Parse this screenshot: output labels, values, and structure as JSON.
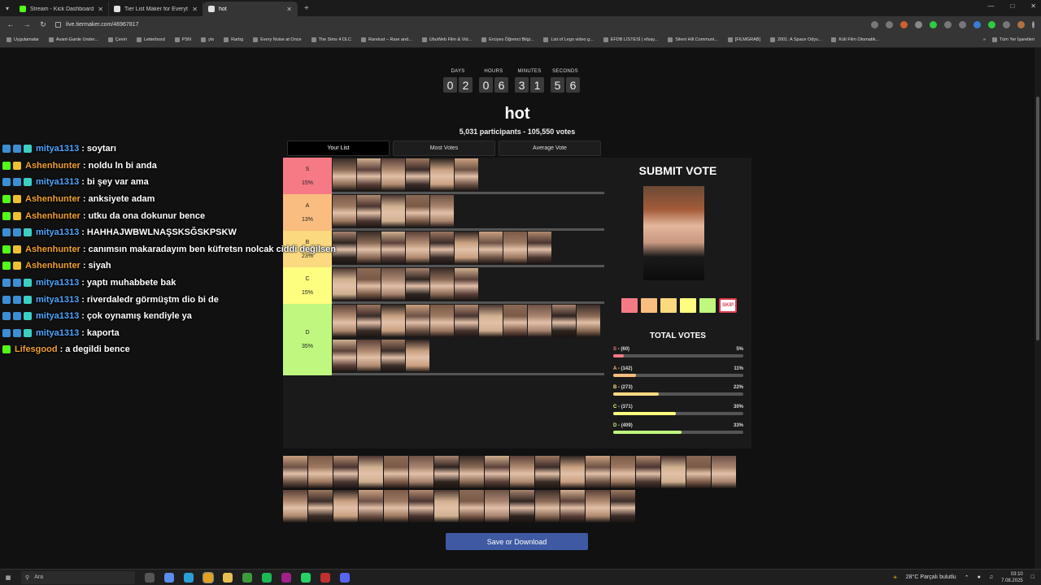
{
  "browser": {
    "tabs": [
      {
        "title": "Stream - Kick Dashboard",
        "icon_color": "#53fc18",
        "active": false
      },
      {
        "title": "Tier List Maker for Everything",
        "icon_color": "#e0e0e0",
        "active": false
      },
      {
        "title": "hot",
        "icon_color": "#e0e0e0",
        "active": true
      }
    ],
    "new_tab": "+",
    "url": "live.tiermaker.com/46967817",
    "bookmarks": [
      "Uygulamalar",
      "Avant-Garde Under...",
      "Çeviri",
      "Letterboxd",
      "PSN",
      "yts",
      "Rarbg",
      "Every Noise at Once",
      "The Sims 4 DLC",
      "Rarelust – Rare and...",
      "UbuWeb Film & Vid...",
      "Erciyes Öğrenci Bilgi...",
      "List of Lego video g...",
      "EFDB LİSTESİ | efsay...",
      "Silent Hill Communi...",
      "[FILMGRAB]",
      "2001: A Space Odys...",
      "Kült Film Otomatik..."
    ],
    "bookmarks_all": "Tüm Yer İşaretleri"
  },
  "countdown": [
    {
      "label": "DAYS",
      "digits": [
        "0",
        "2"
      ]
    },
    {
      "label": "HOURS",
      "digits": [
        "0",
        "6"
      ]
    },
    {
      "label": "MINUTES",
      "digits": [
        "3",
        "1"
      ]
    },
    {
      "label": "SECONDS",
      "digits": [
        "5",
        "6"
      ]
    }
  ],
  "title": "hot",
  "stats": "5,031 participants - 105,550 votes",
  "view_tabs": [
    "Your List",
    "Most Votes",
    "Average Vote"
  ],
  "tiers": [
    {
      "letter": "S",
      "percent": "15%",
      "color": "#f67a85",
      "count": 6
    },
    {
      "letter": "A",
      "percent": "13%",
      "color": "#f9bd7f",
      "count": 5
    },
    {
      "letter": "B",
      "percent": "23%",
      "color": "#fbd97f",
      "count": 9
    },
    {
      "letter": "C",
      "percent": "15%",
      "color": "#fdfd7f",
      "count": 6
    },
    {
      "letter": "D",
      "percent": "35%",
      "color": "#bff77f",
      "count": 15
    }
  ],
  "submit": {
    "title": "SUBMIT VOTE",
    "skip": "SKIP",
    "swatches": [
      "#f67a85",
      "#f9bd7f",
      "#fbd97f",
      "#fdfd7f",
      "#bff77f"
    ]
  },
  "total_votes": {
    "title": "TOTAL VOTES",
    "rows": [
      {
        "label": "S",
        "count": "(60)",
        "percent": "5%",
        "fraction": 0.05,
        "color": "#f67a85"
      },
      {
        "label": "A",
        "count": "(142)",
        "percent": "11%",
        "fraction": 0.11,
        "color": "#f9bd7f"
      },
      {
        "label": "B",
        "count": "(273)",
        "percent": "22%",
        "fraction": 0.22,
        "color": "#fbd97f"
      },
      {
        "label": "C",
        "count": "(371)",
        "percent": "30%",
        "fraction": 0.3,
        "color": "#fdfd7f"
      },
      {
        "label": "D",
        "count": "(409)",
        "percent": "33%",
        "fraction": 0.33,
        "color": "#bff77f"
      }
    ]
  },
  "pool_rows": [
    18,
    14
  ],
  "save_button": "Save or Download",
  "chat": [
    {
      "user": "mitya1313",
      "msg": "soytarı",
      "color": "#4da6ff",
      "badges": [
        "#3c8fd4",
        "#3c8fd4",
        "#3bd0c4"
      ]
    },
    {
      "user": "Ashenhunter",
      "msg": "noldu ln bi anda",
      "color": "#f0a030",
      "badges": [
        "#53fc18",
        "#f0c030"
      ]
    },
    {
      "user": "mitya1313",
      "msg": "bi şey var ama",
      "color": "#4da6ff",
      "badges": [
        "#3c8fd4",
        "#3c8fd4",
        "#3bd0c4"
      ]
    },
    {
      "user": "Ashenhunter",
      "msg": "anksiyete adam",
      "color": "#f0a030",
      "badges": [
        "#53fc18",
        "#f0c030"
      ]
    },
    {
      "user": "Ashenhunter",
      "msg": "utku da ona dokunur bence",
      "color": "#f0a030",
      "badges": [
        "#53fc18",
        "#f0c030"
      ]
    },
    {
      "user": "mitya1313",
      "msg": "HAHHAJWBWLNAŞSKSĞSKPSKW",
      "color": "#4da6ff",
      "badges": [
        "#3c8fd4",
        "#3c8fd4",
        "#3bd0c4"
      ]
    },
    {
      "user": "Ashenhunter",
      "msg": "canımsın makaradayım ben küfretsn nolcak ciddi değilsen",
      "color": "#f0a030",
      "badges": [
        "#53fc18",
        "#f0c030"
      ]
    },
    {
      "user": "Ashenhunter",
      "msg": "siyah",
      "color": "#f0a030",
      "badges": [
        "#53fc18",
        "#f0c030"
      ]
    },
    {
      "user": "mitya1313",
      "msg": "yaptı muhabbete bak",
      "color": "#4da6ff",
      "badges": [
        "#3c8fd4",
        "#3c8fd4",
        "#3bd0c4"
      ]
    },
    {
      "user": "mitya1313",
      "msg": "riverdaledr görmüştm dio bi de",
      "color": "#4da6ff",
      "badges": [
        "#3c8fd4",
        "#3c8fd4",
        "#3bd0c4"
      ]
    },
    {
      "user": "mitya1313",
      "msg": "çok oynamış kendiyle ya",
      "color": "#4da6ff",
      "badges": [
        "#3c8fd4",
        "#3c8fd4",
        "#3bd0c4"
      ]
    },
    {
      "user": "mitya1313",
      "msg": "kaporta",
      "color": "#4da6ff",
      "badges": [
        "#3c8fd4",
        "#3c8fd4",
        "#3bd0c4"
      ]
    },
    {
      "user": "Lifesgood",
      "msg": "a degildi bence",
      "color": "#f0a030",
      "badges": [
        "#53fc18"
      ]
    }
  ],
  "taskbar": {
    "search_placeholder": "Ara",
    "weather": "28°C  Parçalı bulutlu",
    "time": "03:10",
    "date": "7.08.2025"
  }
}
